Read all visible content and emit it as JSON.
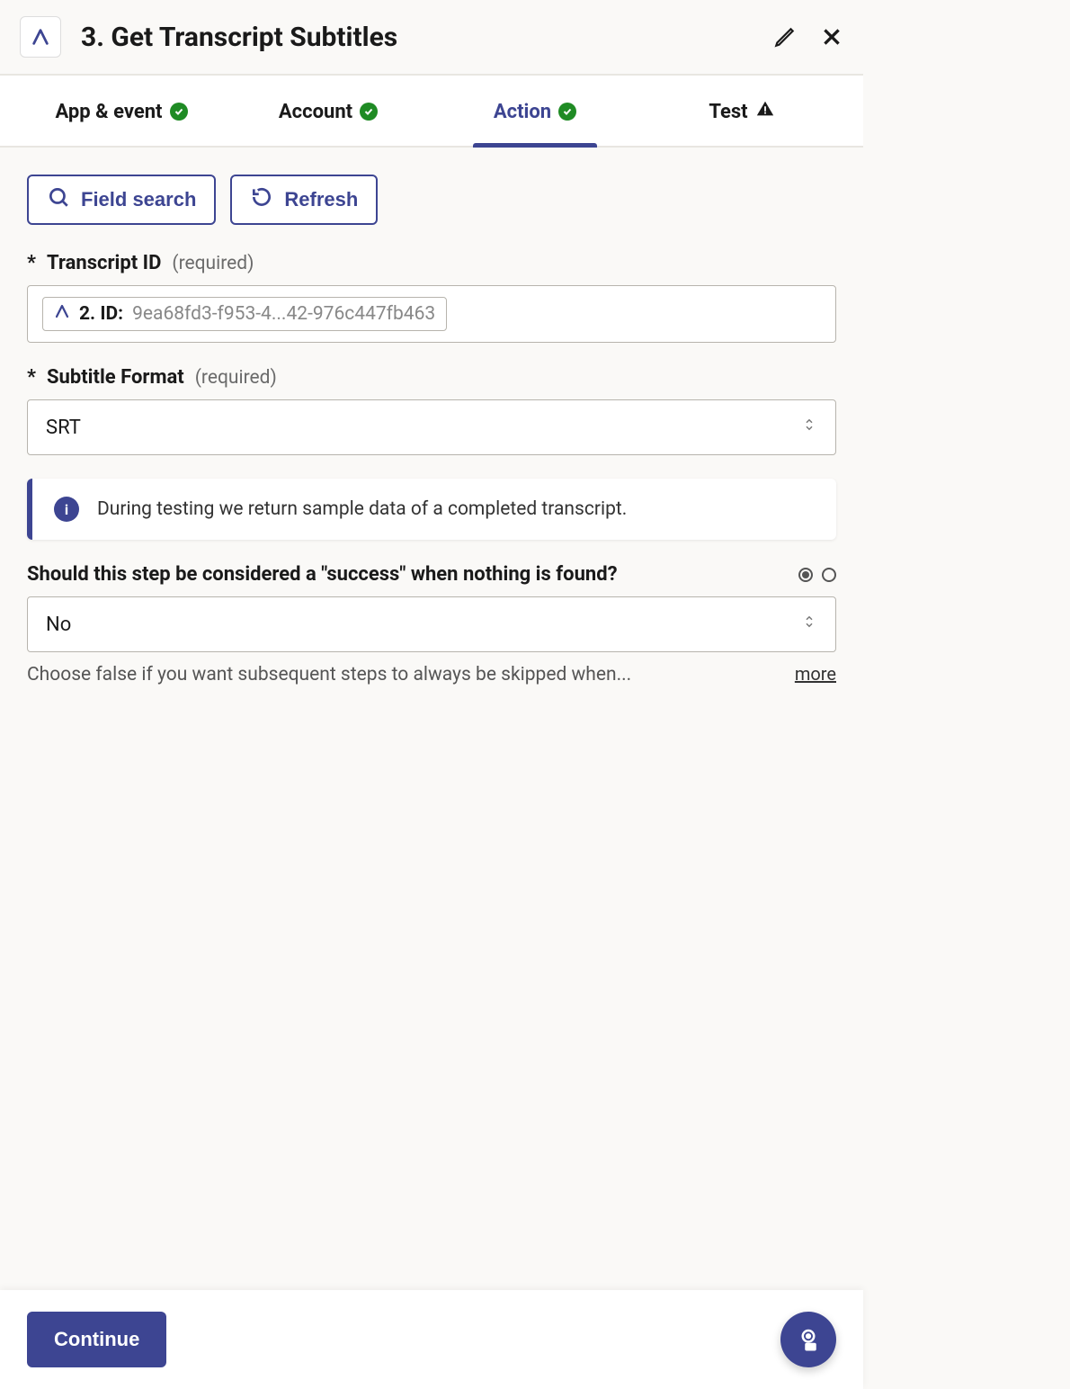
{
  "header": {
    "title": "3. Get Transcript Subtitles"
  },
  "tabs": [
    {
      "label": "App & event",
      "status": "ok",
      "active": false
    },
    {
      "label": "Account",
      "status": "ok",
      "active": false
    },
    {
      "label": "Action",
      "status": "ok",
      "active": true
    },
    {
      "label": "Test",
      "status": "warn",
      "active": false
    }
  ],
  "toolbar": {
    "field_search": "Field search",
    "refresh": "Refresh"
  },
  "fields": {
    "transcript_id": {
      "label": "Transcript ID",
      "required_text": "(required)",
      "pill_label": "2. ID:",
      "pill_value": "9ea68fd3-f953-4...42-976c447fb463"
    },
    "subtitle_format": {
      "label": "Subtitle Format",
      "required_text": "(required)",
      "value": "SRT"
    },
    "success_when_empty": {
      "label": "Should this step be considered a \"success\" when nothing is found?",
      "value": "No",
      "help": "Choose false if you want subsequent steps to always be skipped when...",
      "more": "more"
    }
  },
  "info_banner": {
    "text": "During testing we return sample data of a completed transcript."
  },
  "footer": {
    "continue": "Continue"
  }
}
